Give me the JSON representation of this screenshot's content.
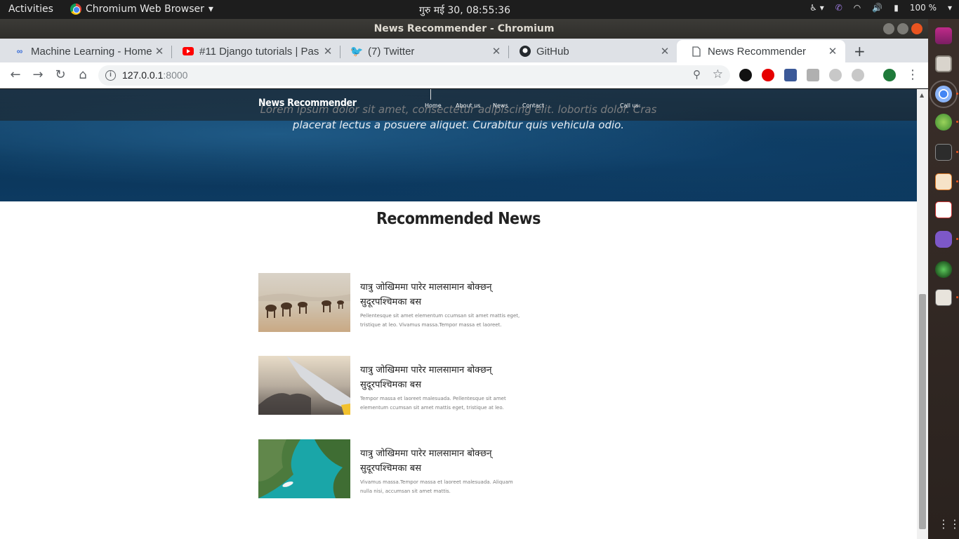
{
  "topbar": {
    "activities": "Activities",
    "app_name": "Chromium Web Browser",
    "clock": "गुरु मई 30, 08:55:36",
    "battery": "100 %"
  },
  "window": {
    "title": "News Recommender - Chromium"
  },
  "tabs": [
    {
      "label": "Machine Learning - Home",
      "icon": "loop-icon"
    },
    {
      "label": "#11 Django tutorials | Pas",
      "icon": "youtube-icon"
    },
    {
      "label": "(7) Twitter",
      "icon": "twitter-icon"
    },
    {
      "label": "GitHub",
      "icon": "github-icon"
    },
    {
      "label": "News Recommender",
      "icon": "page-icon"
    }
  ],
  "address": {
    "host": "127.0.0.1",
    "port": ":8000"
  },
  "site": {
    "brand": "News Recommender",
    "nav": [
      "Home",
      "About us",
      "News",
      "Contact",
      "Call us:"
    ],
    "hero_text": "Lorem ipsum dolor sit amet, consectetur adipiscing elit. lobortis dolor. Cras placerat lectus a posuere aliquet. Curabitur quis vehicula odio.",
    "section_title": "Recommended News",
    "news": [
      {
        "headline": "यात्रु जोखिममा पारेर मालसामान बोक्छन् सुदूरपश्चिमका बस",
        "description": "Pellentesque sit amet elementum ccumsan sit amet mattis eget, tristique at leo. Vivamus massa.Tempor massa et laoreet.",
        "image": "desert-camels"
      },
      {
        "headline": "यात्रु जोखिममा पारेर मालसामान बोक्छन् सुदूरपश्चिमका बस",
        "description": "Tempor massa et laoreet malesuada. Pellentesque sit amet elementum ccumsan sit amet mattis eget, tristique at leo.",
        "image": "airplane-wing"
      },
      {
        "headline": "यात्रु जोखिममा पारेर मालसामान बोक्छन् सुदूरपश्चिमका बस",
        "description": "Vivamus massa.Tempor massa et laoreet malesuada. Aliquam nulla nisi, accumsan sit amet mattis.",
        "image": "island-boat"
      }
    ]
  },
  "colors": {
    "ubuntu_orange": "#e95420",
    "hero_blue": "#0a3559"
  }
}
